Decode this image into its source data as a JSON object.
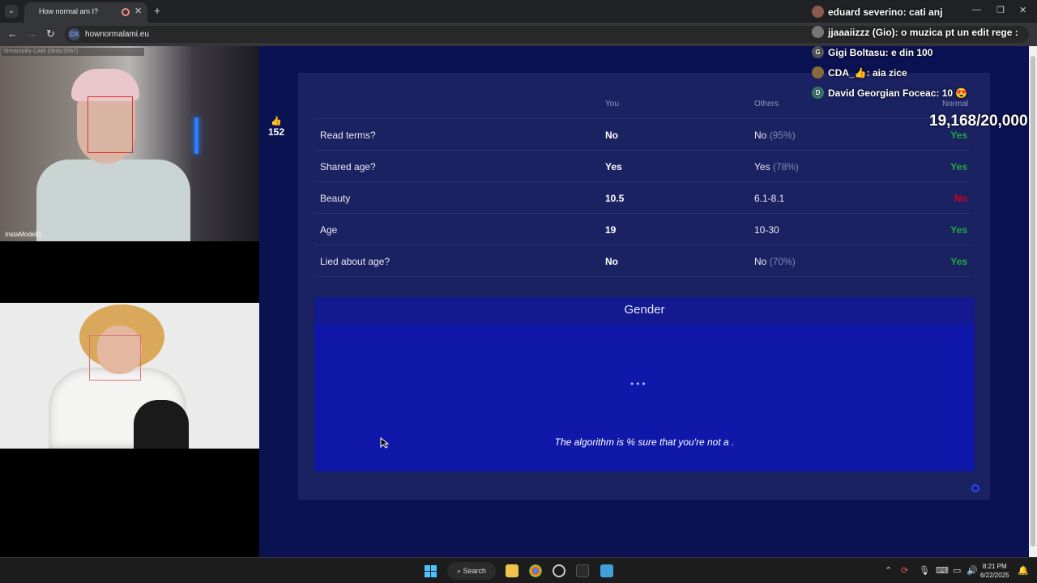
{
  "browser": {
    "tab_title": "How normal am I?",
    "url": "hownormalami.eu",
    "site_icon_text": "DX"
  },
  "webcams": {
    "source_label": "Streamplify CAM (0bda:5567)",
    "cam1_label": "InstaModell1"
  },
  "likes": {
    "count": "152"
  },
  "table": {
    "headers": {
      "you": "You",
      "others": "Others",
      "normal": "Normal"
    },
    "rows": [
      {
        "question": "Read terms?",
        "you": "No",
        "others": "No",
        "others_pct": "(95%)",
        "normal": "Yes",
        "normal_ok": true
      },
      {
        "question": "Shared age?",
        "you": "Yes",
        "others": "Yes",
        "others_pct": "(78%)",
        "normal": "Yes",
        "normal_ok": true
      },
      {
        "question": "Beauty",
        "you": "10.5",
        "others": "6.1-8.1",
        "others_pct": "",
        "normal": "No",
        "normal_ok": false
      },
      {
        "question": "Age",
        "you": "19",
        "others": "10-30",
        "others_pct": "",
        "normal": "Yes",
        "normal_ok": true
      },
      {
        "question": "Lied about age?",
        "you": "No",
        "others": "No",
        "others_pct": "(70%)",
        "normal": "Yes",
        "normal_ok": true
      }
    ]
  },
  "gender": {
    "title": "Gender",
    "loading": "•••",
    "algorithm_text": "The algorithm is % sure that you're not a ."
  },
  "chat": [
    {
      "avatar": "",
      "user": "eduard severino:",
      "text": "cati anj"
    },
    {
      "avatar": "",
      "user": "jjaaaiizzz (Gio):",
      "text": "o muzica pt un edit rege :"
    },
    {
      "avatar": "G",
      "user": "Gigi Boltasu:",
      "text": "e din 100"
    },
    {
      "avatar": "",
      "user": "CDA_👍:",
      "text": "aia zice"
    },
    {
      "avatar": "D",
      "user": "David Georgian Foceac:",
      "text": "10 😍"
    }
  ],
  "viewer_counter": "19,168/20,000",
  "taskbar": {
    "search_label": "Search",
    "time": "8:21 PM",
    "date": "6/22/2025"
  },
  "colors": {
    "page_bg": "#0b1251",
    "panel_bg": "#1b2262",
    "gender_bg": "#0f18a8",
    "ok": "#1fab3f",
    "bad": "#d3001a"
  }
}
